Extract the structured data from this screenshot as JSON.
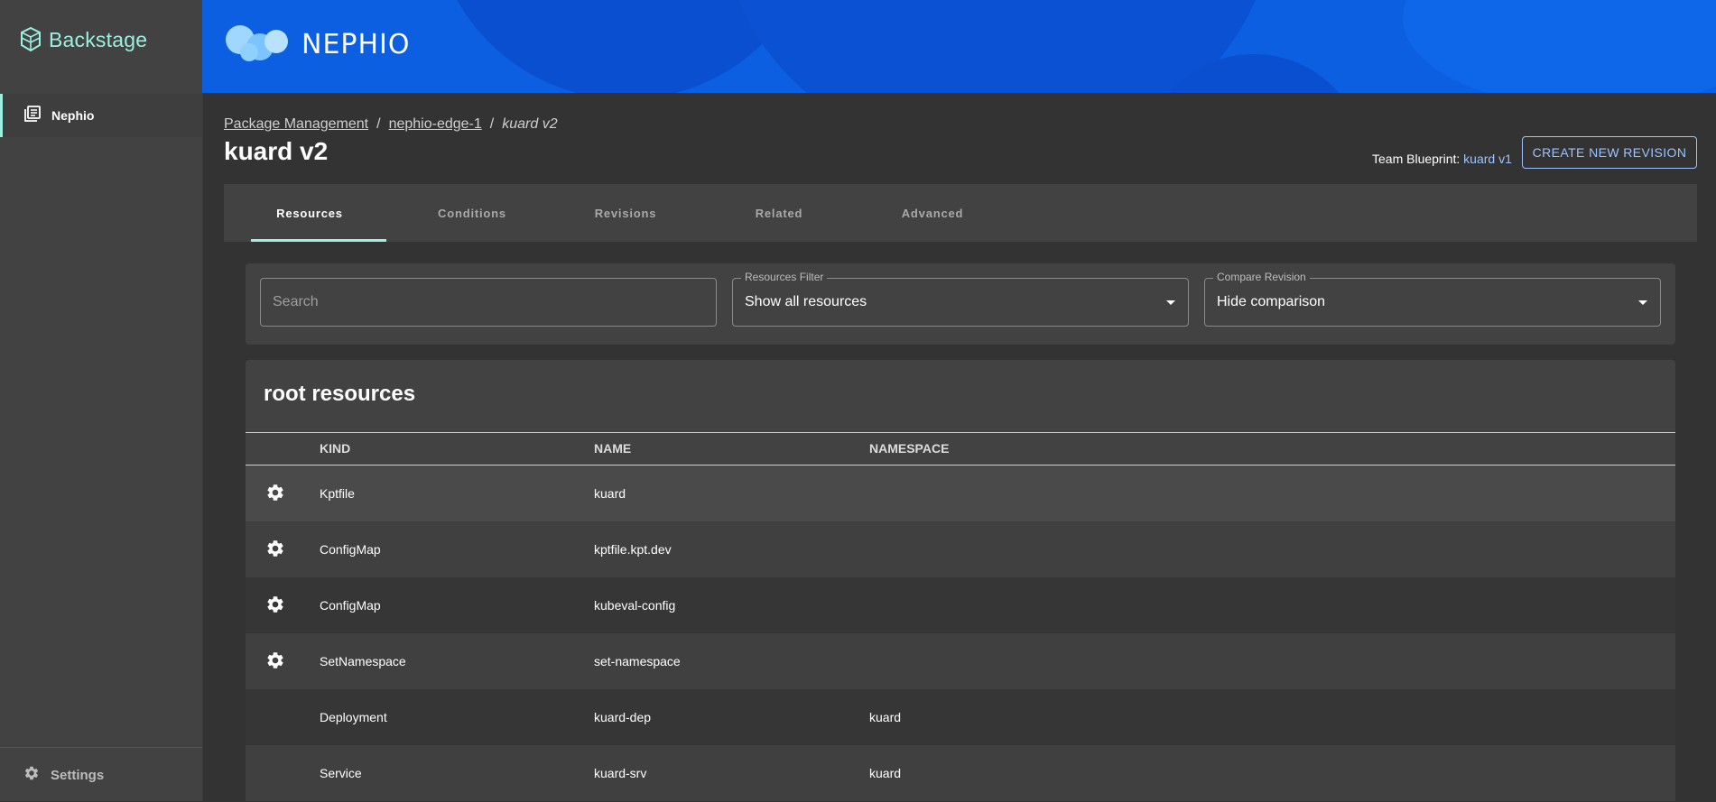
{
  "sidebar": {
    "brand": "Backstage",
    "items": [
      {
        "label": "Nephio",
        "icon": "library-icon"
      }
    ],
    "settings_label": "Settings"
  },
  "header": {
    "logo_text": "NEPHIO"
  },
  "breadcrumb": {
    "items": [
      "Package Management",
      "nephio-edge-1"
    ],
    "current": "kuard v2",
    "separator": "/"
  },
  "page": {
    "title": "kuard v2",
    "blueprint_label": "Team Blueprint:",
    "blueprint_link": "kuard v1",
    "create_button": "CREATE NEW REVISION"
  },
  "tabs": [
    "Resources",
    "Conditions",
    "Revisions",
    "Related",
    "Advanced"
  ],
  "filters": {
    "search_placeholder": "Search",
    "resources_filter_label": "Resources Filter",
    "resources_filter_value": "Show all resources",
    "compare_label": "Compare Revision",
    "compare_value": "Hide comparison"
  },
  "table": {
    "title": "root resources",
    "columns": [
      "KIND",
      "NAME",
      "NAMESPACE"
    ],
    "rows": [
      {
        "kind": "Kptfile",
        "name": "kuard",
        "namespace": "",
        "function": true
      },
      {
        "kind": "ConfigMap",
        "name": "kptfile.kpt.dev",
        "namespace": "",
        "function": true
      },
      {
        "kind": "ConfigMap",
        "name": "kubeval-config",
        "namespace": "",
        "function": true
      },
      {
        "kind": "SetNamespace",
        "name": "set-namespace",
        "namespace": "",
        "function": true
      },
      {
        "kind": "Deployment",
        "name": "kuard-dep",
        "namespace": "kuard",
        "function": false
      },
      {
        "kind": "Service",
        "name": "kuard-srv",
        "namespace": "kuard",
        "function": false
      }
    ]
  },
  "colors": {
    "accent": "#9bf0e1",
    "link": "#9cc3ff",
    "header_blue": "#0b5fe0"
  }
}
